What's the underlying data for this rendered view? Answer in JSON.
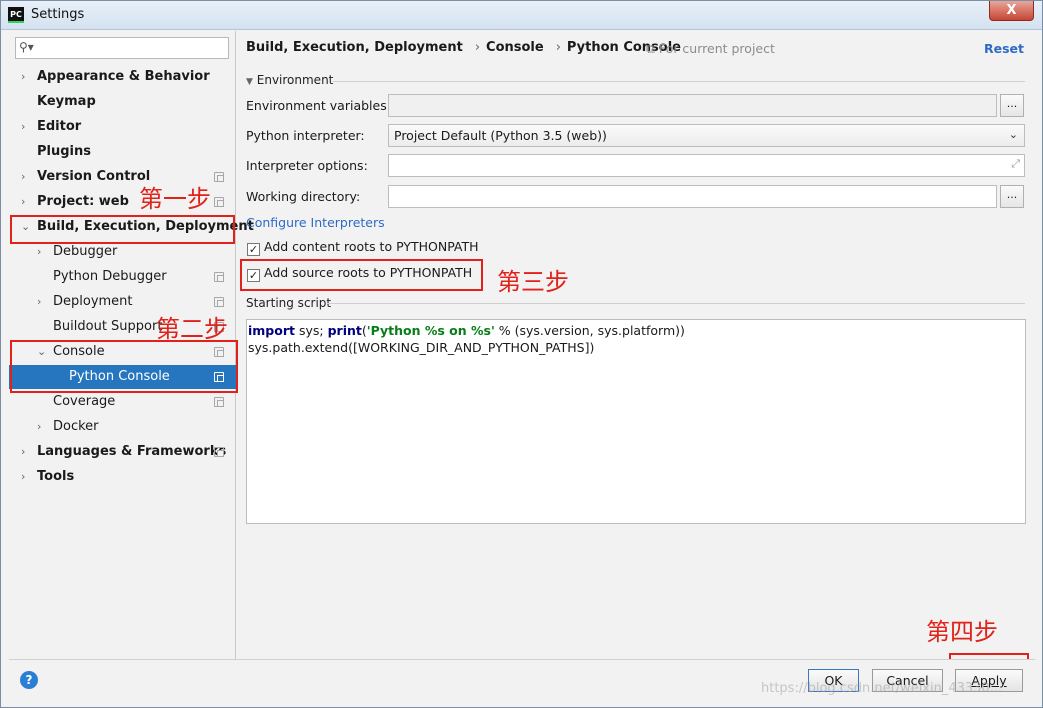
{
  "window": {
    "app_icon": "PC",
    "title": "Settings",
    "close_label": "X"
  },
  "search": {
    "placeholder": "",
    "icon": "search-icon"
  },
  "tree": [
    {
      "label": "Appearance & Behavior",
      "arrow": "›",
      "copy": false
    },
    {
      "label": "Keymap",
      "arrow": "",
      "copy": false
    },
    {
      "label": "Editor",
      "arrow": "›",
      "copy": false
    },
    {
      "label": "Plugins",
      "arrow": "",
      "copy": false
    },
    {
      "label": "Version Control",
      "arrow": "›",
      "copy": true
    },
    {
      "label": "Project: web",
      "arrow": "›",
      "copy": true
    },
    {
      "label": "Build, Execution, Deployment",
      "arrow": "⌄",
      "copy": false
    },
    {
      "label": "Debugger",
      "arrow": "›",
      "copy": false
    },
    {
      "label": "Python Debugger",
      "arrow": "",
      "copy": true
    },
    {
      "label": "Deployment",
      "arrow": "›",
      "copy": true
    },
    {
      "label": "Buildout Support",
      "arrow": "",
      "copy": true
    },
    {
      "label": "Console",
      "arrow": "⌄",
      "copy": true
    },
    {
      "label": "Python Console",
      "arrow": "",
      "copy": true
    },
    {
      "label": "Coverage",
      "arrow": "",
      "copy": true
    },
    {
      "label": "Docker",
      "arrow": "›",
      "copy": false
    },
    {
      "label": "Languages & Frameworks",
      "arrow": "›",
      "copy": true
    },
    {
      "label": "Tools",
      "arrow": "›",
      "copy": false
    }
  ],
  "annotations": {
    "step1": "第一步",
    "step2": "第二步",
    "step3": "第三步",
    "step4": "第四步"
  },
  "header": {
    "crumb1": "Build, Execution, Deployment",
    "crumb2": "Console",
    "crumb3": "Python Console",
    "separator": "›",
    "scope": "For current project",
    "reset": "Reset"
  },
  "environment": {
    "section_title": "Environment",
    "env_vars_label": "Environment variables:",
    "env_vars_value": "",
    "interpreter_label": "Python interpreter:",
    "interpreter_value": "Project Default (Python 3.5 (web))",
    "options_label": "Interpreter options:",
    "options_value": "",
    "workdir_label": "Working directory:",
    "workdir_value": "",
    "browse_label": "...",
    "configure_link": "Configure Interpreters",
    "content_roots_label": "Add content roots to PYTHONPATH",
    "content_roots_checked": true,
    "source_roots_label": "Add source roots to PYTHONPATH",
    "source_roots_checked": true
  },
  "script": {
    "section_title": "Starting script",
    "line1_kw1": "import",
    "line1_a": " sys; ",
    "line1_kw2": "print",
    "line1_b": "(",
    "line1_str": "'Python %s on %s'",
    "line1_c": " % (sys.version, sys.platform))",
    "line2": "sys.path.extend([WORKING_DIR_AND_PYTHON_PATHS])"
  },
  "buttons": {
    "ok": "OK",
    "cancel": "Cancel",
    "apply": "Apply",
    "help": "?"
  },
  "watermark": "https://blog.csdn.net/weixin_43330..."
}
